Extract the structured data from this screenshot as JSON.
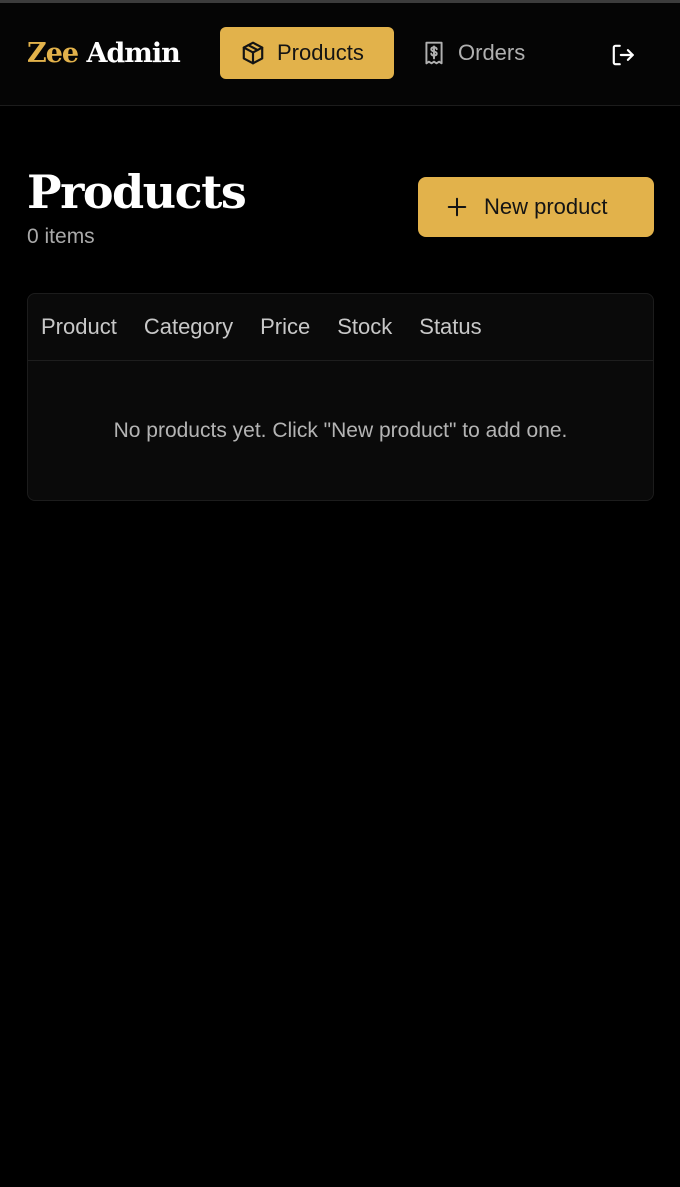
{
  "brand": {
    "accent_text": "Zee",
    "rest_text": "Admin",
    "accent_color": "#e2b24b"
  },
  "nav": {
    "tabs": [
      {
        "label": "Products",
        "icon": "package-icon",
        "active": true
      },
      {
        "label": "Orders",
        "icon": "receipt-dollar-icon",
        "active": false
      }
    ],
    "logout_icon": "logout-icon"
  },
  "page": {
    "title": "Products",
    "item_count": "0 items",
    "new_button_label": "New product",
    "new_button_icon": "plus-icon"
  },
  "table": {
    "columns": [
      "Product",
      "Category",
      "Price",
      "Stock",
      "Status"
    ],
    "rows": [],
    "empty_message": "No products yet. Click \"New product\" to add one."
  },
  "colors": {
    "background": "#000000",
    "accent": "#e2b24b",
    "card": "#0a0a0a",
    "muted_text": "#a9a9a9"
  }
}
